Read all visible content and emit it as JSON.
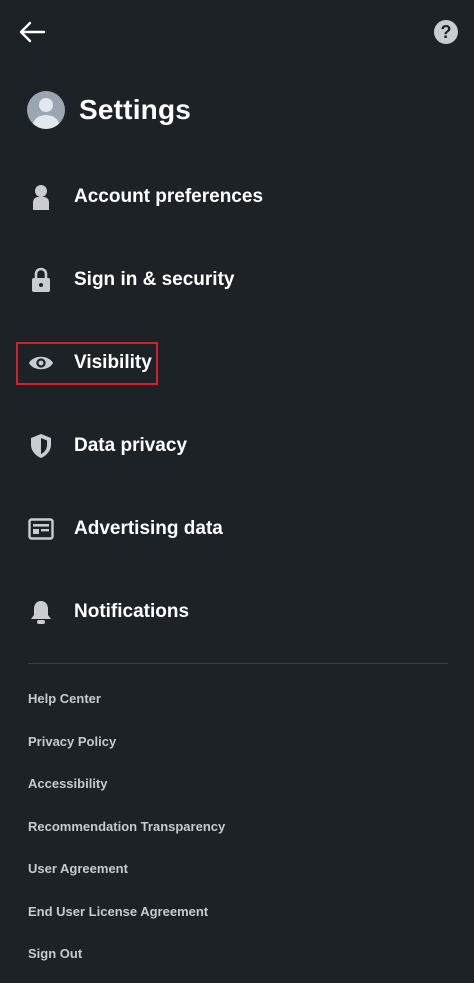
{
  "header": {
    "title": "Settings",
    "back_icon": "arrow-left-icon",
    "help_label": "?"
  },
  "menu": {
    "items": [
      {
        "label": "Account preferences",
        "icon": "person-icon"
      },
      {
        "label": "Sign in & security",
        "icon": "lock-icon"
      },
      {
        "label": "Visibility",
        "icon": "eye-icon",
        "highlighted": true
      },
      {
        "label": "Data privacy",
        "icon": "shield-icon"
      },
      {
        "label": "Advertising data",
        "icon": "ad-card-icon"
      },
      {
        "label": "Notifications",
        "icon": "bell-icon"
      }
    ]
  },
  "footer": {
    "links": [
      "Help Center",
      "Privacy Policy",
      "Accessibility",
      "Recommendation Transparency",
      "User Agreement",
      "End User License Agreement",
      "Sign Out"
    ]
  },
  "colors": {
    "background": "#1d2226",
    "text": "#ffffff",
    "secondary_text": "#c7cbcf",
    "highlight": "#d3202a"
  }
}
